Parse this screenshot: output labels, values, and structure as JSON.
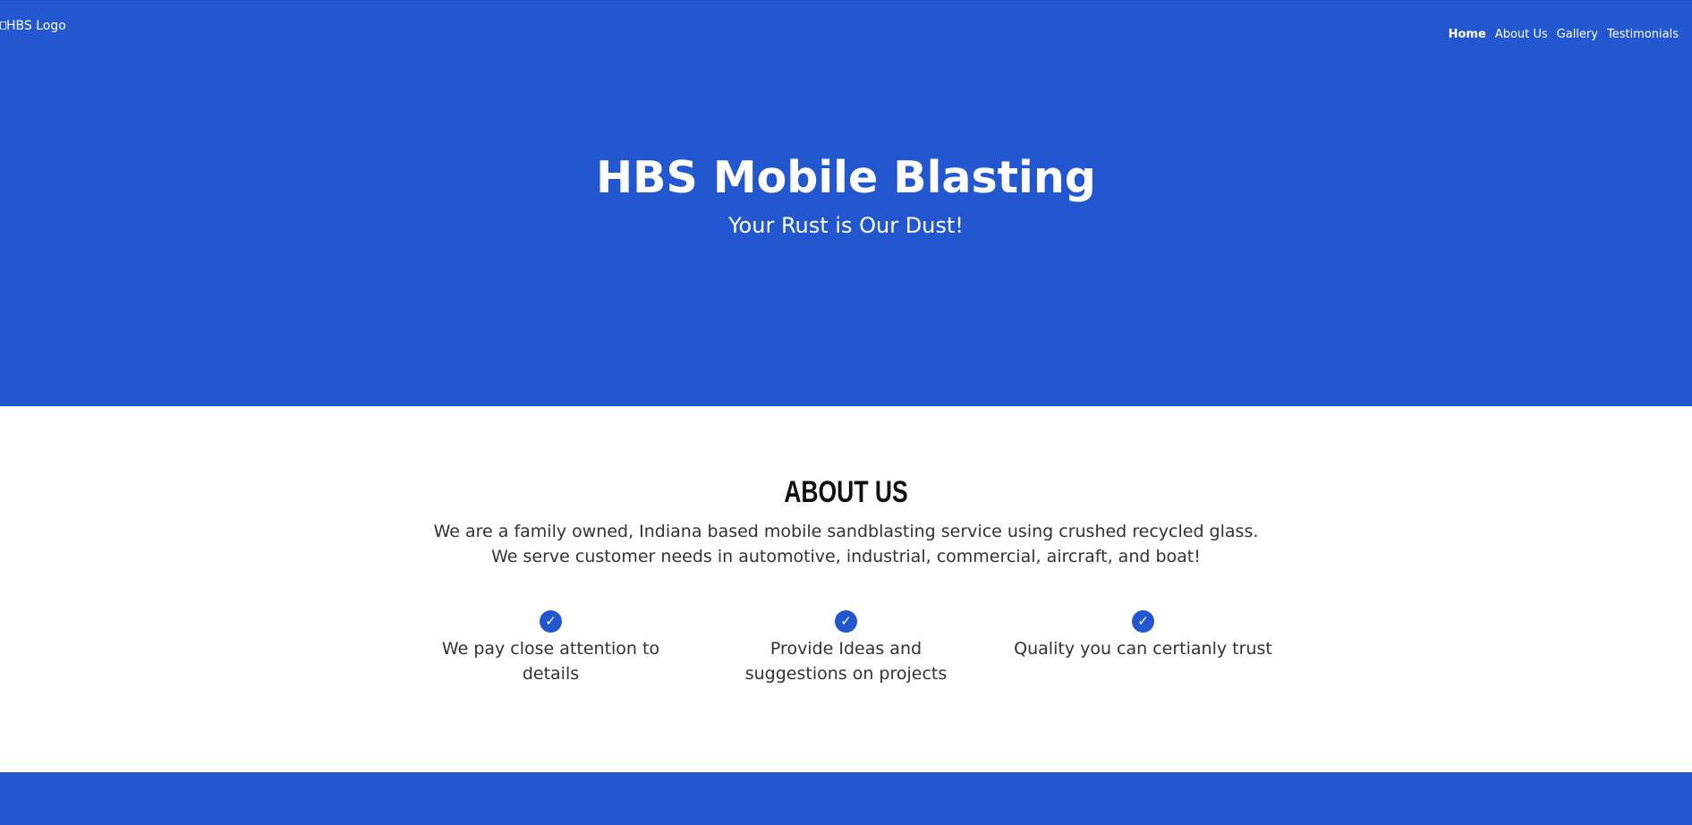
{
  "header": {
    "logo_alt": "HBS Logo",
    "nav": [
      {
        "label": "Home",
        "active": true
      },
      {
        "label": "About Us",
        "active": false
      },
      {
        "label": "Gallery",
        "active": false
      },
      {
        "label": "Testimonials",
        "active": false
      }
    ]
  },
  "hero": {
    "title": "HBS Mobile Blasting",
    "subtitle": "Your Rust is Our Dust!"
  },
  "about": {
    "heading": "ABOUT US",
    "description": "We are a family owned, Indiana based mobile sandblasting service using crushed recycled glass. We serve customer needs in automotive, industrial, commercial, aircraft, and boat!",
    "features": [
      {
        "icon": "check-circle-icon",
        "text": "We pay close attention to details"
      },
      {
        "icon": "check-circle-icon",
        "text": "Provide Ideas and suggestions on projects"
      },
      {
        "icon": "check-circle-icon",
        "text": "Quality you can certianly trust"
      }
    ]
  },
  "colors": {
    "brand_blue": "#2257d0",
    "background": "#ffffff",
    "body_text": "#323232",
    "heading_text": "#111111"
  }
}
